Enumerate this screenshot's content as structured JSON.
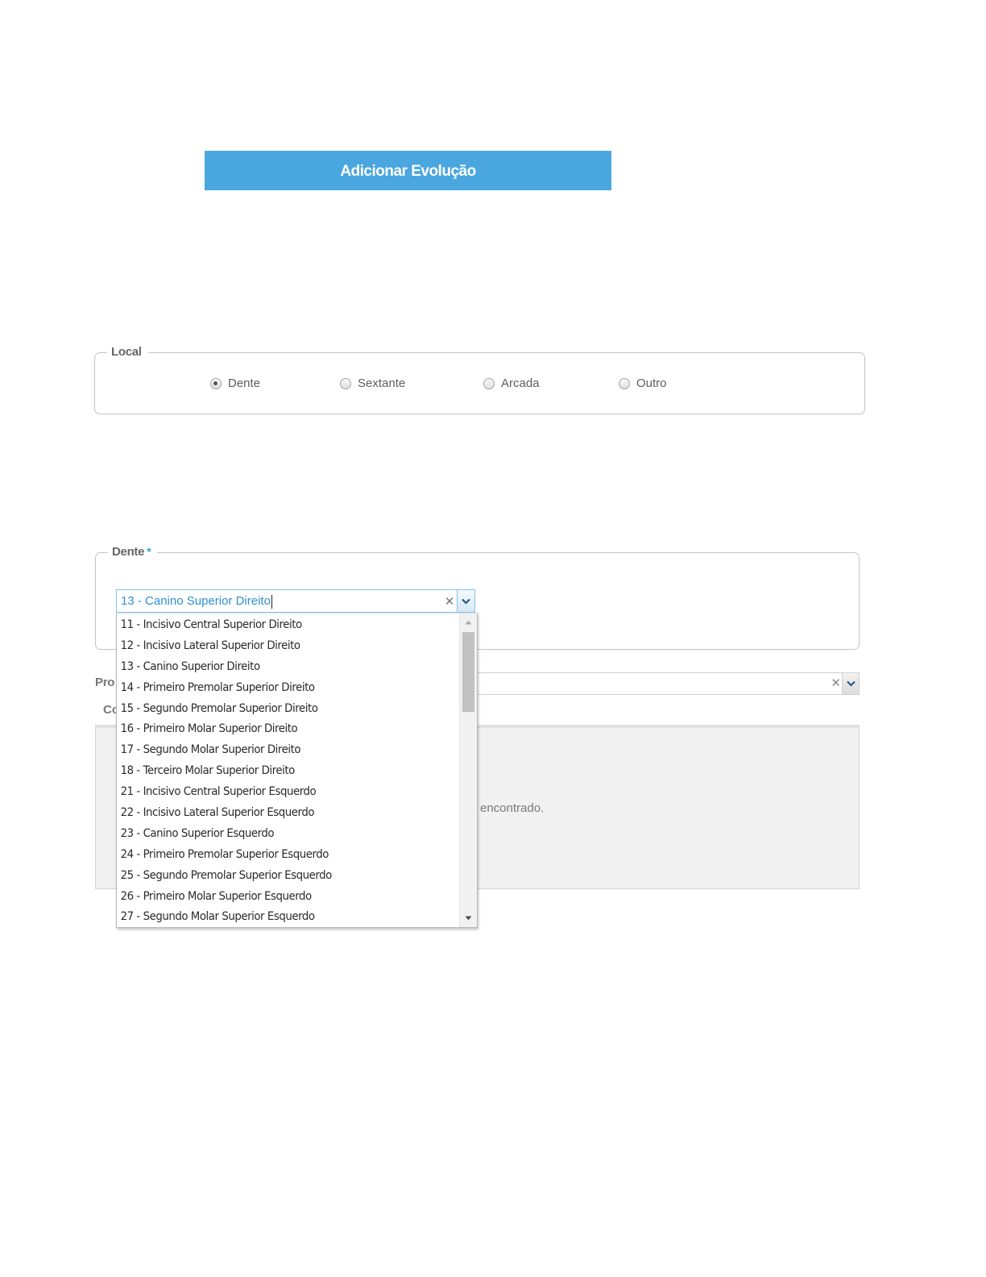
{
  "banner": {
    "title": "Adicionar Evolução"
  },
  "local": {
    "legend": "Local",
    "options": [
      {
        "label": "Dente",
        "checked": true
      },
      {
        "label": "Sextante",
        "checked": false
      },
      {
        "label": "Arcada",
        "checked": false
      },
      {
        "label": "Outro",
        "checked": false
      }
    ]
  },
  "dente": {
    "legend": "Dente",
    "required_marker": "*",
    "selected_value": "13 - Canino Superior Direito",
    "clear_icon": "close-icon",
    "dropdown_icon": "chevron-down-icon",
    "options": [
      "11 - Incisivo Central Superior Direito",
      "12 - Incisivo Lateral Superior Direito",
      "13 - Canino Superior Direito",
      "14 - Primeiro Premolar Superior Direito",
      "15 - Segundo Premolar Superior Direito",
      "16 - Primeiro Molar Superior Direito",
      "17 - Segundo Molar Superior Direito",
      "18 - Terceiro Molar Superior Direito",
      "21 - Incisivo Central Superior Esquerdo",
      "22 - Incisivo Lateral Superior Esquerdo",
      "23 - Canino Superior Esquerdo",
      "24 - Primeiro Premolar Superior Esquerdo",
      "25 - Segundo Premolar Superior Esquerdo",
      "26 - Primeiro Molar Superior Esquerdo",
      "27 - Segundo Molar Superior Esquerdo"
    ]
  },
  "background": {
    "proc_label_fragment": "Pro",
    "co_label_fragment": "Co",
    "grid_empty_fragment": "encontrado."
  },
  "colors": {
    "banner_bg": "#4aa6df",
    "accent": "#2ea0de",
    "selected_text": "#2f8fd0"
  }
}
